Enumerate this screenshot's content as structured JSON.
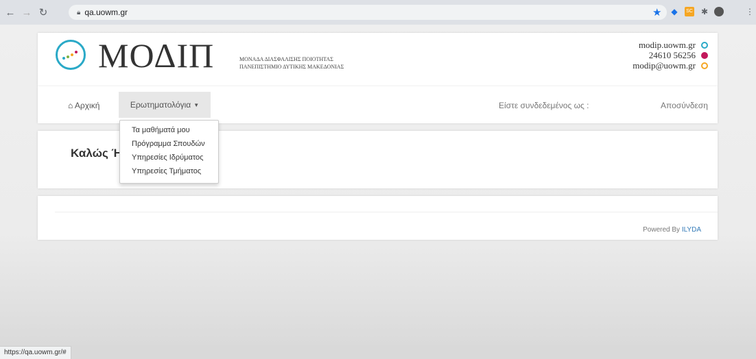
{
  "browser": {
    "url": "qa.uowm.gr",
    "status_url": "https://qa.uowm.gr/#"
  },
  "header": {
    "logo_text": "ΜΟΔΙΠ",
    "subtitle_line1": "ΜΟΝΑΔΑ ΔΙΑΣΦΑΛΙΣΗΣ ΠΟΙΟΤΗΤΑΣ",
    "subtitle_line2": "ΠΑΝΕΠΙΣΤΗΜΙΟ ΔΥΤΙΚΗΣ ΜΑΚΕΔΟΝΙΑΣ",
    "contact": {
      "web": "modip.uowm.gr",
      "phone": "24610 56256",
      "email": "modip@uowm.gr"
    },
    "contact_colors": {
      "web": "#2aa9c7",
      "phone": "#c2185b",
      "email": "#f5a623"
    }
  },
  "nav": {
    "home_label": "Αρχική",
    "questionnaires_label": "Ερωτηματολόγια",
    "logged_in_label": "Είστε συνδεδεμένος ως :",
    "logout_label": "Αποσύνδεση"
  },
  "dropdown": {
    "items": [
      "Τα μαθήματά μου",
      "Πρόγραμμα Σπουδών",
      "Υπηρεσίες Ιδρύματος",
      "Υπηρεσίες Τμήματος"
    ]
  },
  "welcome": {
    "title": "Καλώς Ή"
  },
  "footer": {
    "powered_by": "Powered By",
    "powered_link": "ILYDA"
  },
  "colors": {
    "link": "#337ab7",
    "star": "#1a73e8"
  }
}
